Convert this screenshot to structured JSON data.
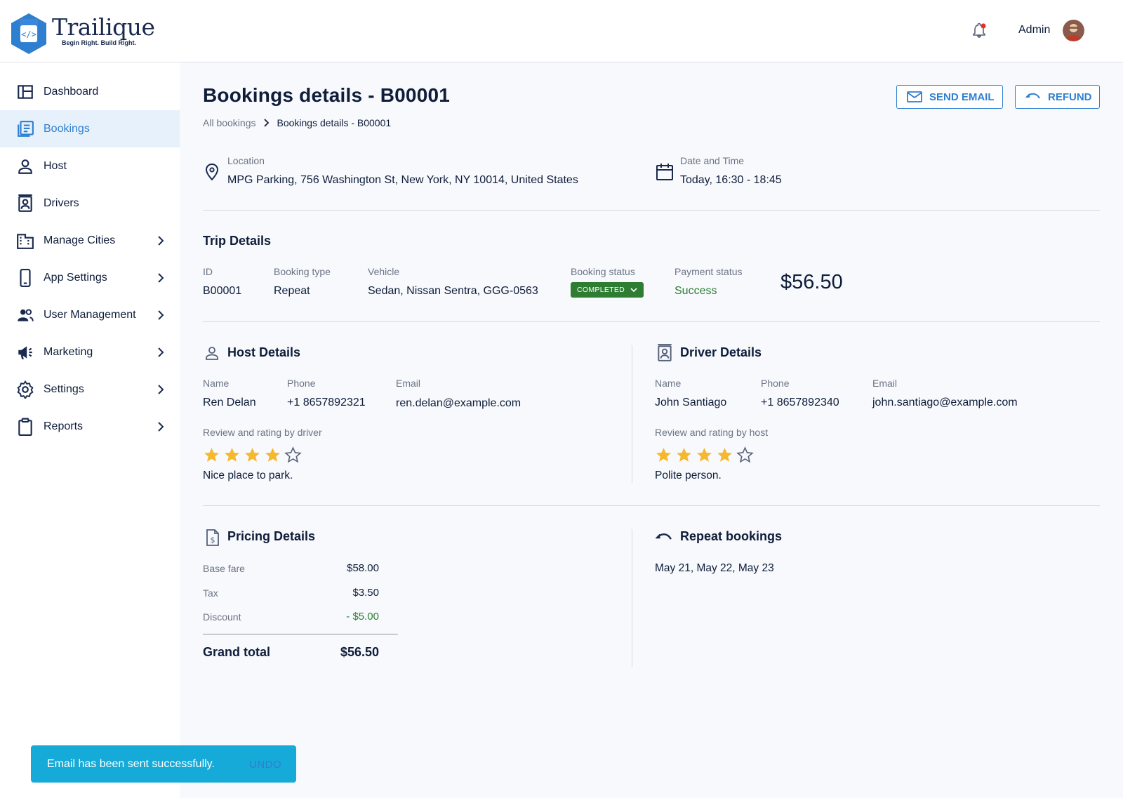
{
  "brand": {
    "name": "Trailique",
    "tagline": "Begin Right. Build Right."
  },
  "header": {
    "user_name": "Admin"
  },
  "sidebar": {
    "items": [
      {
        "label": "Dashboard"
      },
      {
        "label": "Bookings"
      },
      {
        "label": "Host"
      },
      {
        "label": "Drivers"
      },
      {
        "label": "Manage Cities"
      },
      {
        "label": "App Settings"
      },
      {
        "label": "User Management"
      },
      {
        "label": "Marketing"
      },
      {
        "label": "Settings"
      },
      {
        "label": "Reports"
      }
    ],
    "active": "Bookings"
  },
  "page": {
    "title": "Bookings details - B00001",
    "breadcrumb": {
      "parent": "All bookings",
      "current": "Bookings details - B00001"
    },
    "actions": {
      "send_email": "SEND EMAIL",
      "refund": "REFUND"
    }
  },
  "location": {
    "label": "Location",
    "value": "MPG Parking, 756 Washington St, New York, NY 10014, United States"
  },
  "datetime": {
    "label": "Date and Time",
    "value": "Today, 16:30 - 18:45"
  },
  "trip": {
    "title": "Trip Details",
    "id_label": "ID",
    "id": "B00001",
    "type_label": "Booking type",
    "type": "Repeat",
    "vehicle_label": "Vehicle",
    "vehicle": "Sedan, Nissan Sentra, GGG-0563",
    "status_label": "Booking status",
    "status": "COMPLETED",
    "payment_label": "Payment status",
    "payment": "Success",
    "amount": "$56.50"
  },
  "host": {
    "title": "Host Details",
    "name_label": "Name",
    "name": "Ren Delan",
    "phone_label": "Phone",
    "phone": "+1  8657892321",
    "email_label": "Email",
    "email": "ren.delan@example.com",
    "review_label": "Review and rating by driver",
    "rating": 4,
    "rating_max": 5,
    "review": "Nice place to park."
  },
  "driver": {
    "title": "Driver Details",
    "name_label": "Name",
    "name": "John Santiago",
    "phone_label": "Phone",
    "phone": "+1  8657892340",
    "email_label": "Email",
    "email": "john.santiago@example.com",
    "review_label": "Review and rating by host",
    "rating": 4,
    "rating_max": 5,
    "review": "Polite person."
  },
  "pricing": {
    "title": "Pricing Details",
    "base_label": "Base fare",
    "base": "$58.00",
    "tax_label": "Tax",
    "tax": "$3.50",
    "discount_label": "Discount",
    "discount": "- $5.00",
    "total_label": "Grand total",
    "total": "$56.50"
  },
  "repeat": {
    "title": "Repeat bookings",
    "dates": "May 21, May 22, May 23"
  },
  "toast": {
    "message": "Email has been sent successfully.",
    "undo": "UNDO"
  },
  "colors": {
    "accent": "#2f7fd0",
    "success": "#2e7d32",
    "star": "#f5b82e",
    "toast": "#16aad9",
    "active_bg": "#e6f1fc"
  }
}
